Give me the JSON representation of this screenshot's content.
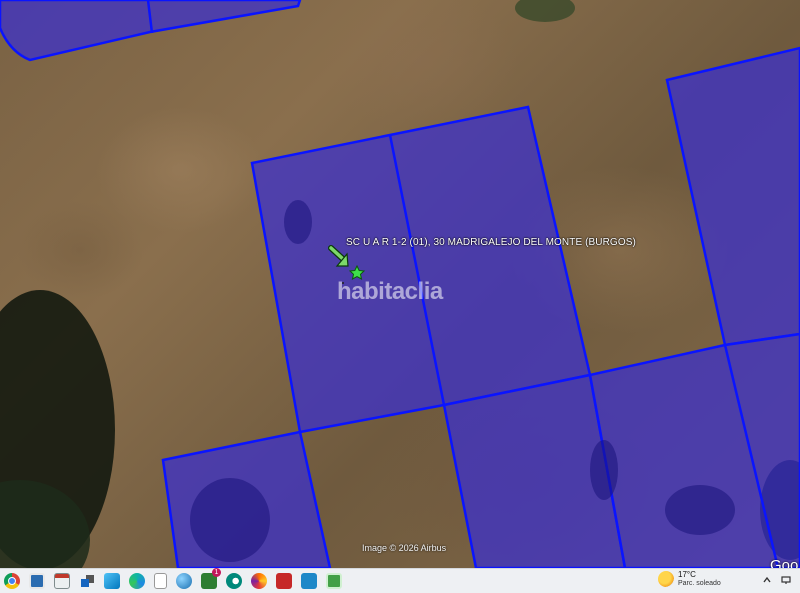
{
  "map": {
    "parcel_label": "SC U A  R 1-2 (01), 30  MADRIGALEJO DEL MONTE (BURGOS)",
    "watermark": "habitaclia",
    "imagery_credit": "Image © 2026 Airbus",
    "provider_logo": "Goo",
    "parcel_fill": "#3a2fd0",
    "parcel_stroke": "#0a14ff",
    "marker_icon": "green-star-icon",
    "pointer_icon": "green-arrow-icon"
  },
  "taskbar": {
    "icons": [
      "chrome-icon",
      "presentation-icon",
      "window-icon",
      "task-view-icon",
      "photos-icon",
      "edge-icon",
      "file-icon",
      "globe-icon",
      "whatsapp-icon",
      "cloud-icon",
      "firefox-icon",
      "acrobat-icon",
      "s-app-icon",
      "green-app-icon"
    ],
    "whatsapp_badge": "1",
    "weather": {
      "temperature": "17°C",
      "condition": "Parc. soleado"
    }
  }
}
